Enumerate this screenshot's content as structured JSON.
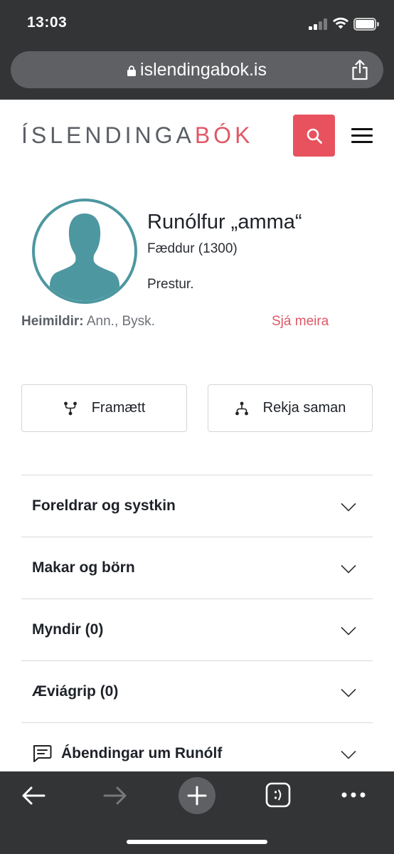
{
  "status_bar": {
    "time": "13:03"
  },
  "browser": {
    "url": "islendingabok.is"
  },
  "site": {
    "logo_main": "ÍSLENDINGA",
    "logo_accent": "BÓK"
  },
  "person": {
    "name": "Runólfur „amma“",
    "born": "Fæddur (1300)",
    "occupation": "Prestur.",
    "sources_label": "Heimildir:",
    "sources_value": "Ann., Bysk.",
    "see_more": "Sjá meira"
  },
  "actions": {
    "forward_label": "Framætt",
    "relate_label": "Rekja saman"
  },
  "sections": [
    {
      "label": "Foreldrar og systkin"
    },
    {
      "label": "Makar og börn"
    },
    {
      "label": "Myndir (0)"
    },
    {
      "label": "Æviágrip (0)"
    },
    {
      "label": "Ábendingar um Runólf"
    }
  ],
  "colors": {
    "accent": "#e8525f",
    "avatar": "#4d97a0",
    "chrome": "#333436"
  },
  "icons": {
    "search": "search-icon",
    "menu": "hamburger-menu-icon",
    "lock": "lock-icon",
    "share": "share-icon",
    "back": "back-arrow-icon",
    "forward": "forward-arrow-icon",
    "new_tab": "plus-icon",
    "tabs": "tabs-icon",
    "more": "more-icon"
  }
}
